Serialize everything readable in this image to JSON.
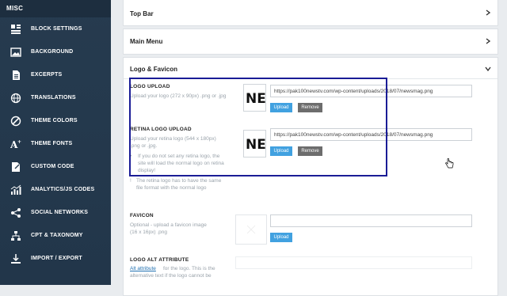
{
  "sidebar": {
    "heading": "MISC",
    "items": [
      {
        "label": "BLOCK SETTINGS",
        "icon": "layout-icon"
      },
      {
        "label": "BACKGROUND",
        "icon": "image-icon"
      },
      {
        "label": "EXCERPTS",
        "icon": "document-icon"
      },
      {
        "label": "TRANSLATIONS",
        "icon": "globe-icon"
      },
      {
        "label": "THEME COLORS",
        "icon": "palette-icon"
      },
      {
        "label": "THEME FONTS",
        "icon": "font-icon"
      },
      {
        "label": "CUSTOM CODE",
        "icon": "code-icon"
      },
      {
        "label": "ANALYTICS/JS CODES",
        "icon": "chart-icon"
      },
      {
        "label": "SOCIAL NETWORKS",
        "icon": "share-icon"
      },
      {
        "label": "CPT & TAXONOMY",
        "icon": "tree-icon"
      },
      {
        "label": "IMPORT / EXPORT",
        "icon": "import-icon"
      }
    ]
  },
  "panels": {
    "top_bar": "Top Bar",
    "main_menu": "Main Menu",
    "logo_favicon": "Logo & Favicon"
  },
  "logo_upload": {
    "label": "LOGO UPLOAD",
    "desc": "Upload your logo (272 x 90px) .png or .jpg",
    "url": "https://pak100newstv.com/wp-content/uploads/2018/07/newsmag.png",
    "preview_text": "NE",
    "upload": "Upload",
    "remove": "Remove"
  },
  "retina_logo": {
    "label": "RETINA LOGO UPLOAD",
    "desc1": "Upload your retina logo (544 x 180px)",
    "desc2": ".png or .jpg.",
    "note1": "If you do not set any retina logo, the",
    "note2": "site will load the normal logo on retina",
    "note3": "display!",
    "note4": "The retina logo has to have the same",
    "note5": "file format with the normal logo",
    "url": "https://pak100newstv.com/wp-content/uploads/2018/07/newsmag.png",
    "preview_text": "NE",
    "upload": "Upload",
    "remove": "Remove"
  },
  "favicon": {
    "label": "FAVICON",
    "desc1": "Optional - upload a favicon image",
    "desc2": "(16 x 16px) .png",
    "upload": "Upload"
  },
  "logo_alt": {
    "label": "LOGO ALT ATTRIBUTE",
    "link": "Alt attribute",
    "desc1": "for the logo. This is the",
    "desc2": "alternative text if the logo cannot be"
  },
  "colors": {
    "sidebar": "#263b4f",
    "accent": "#41a1e0",
    "highlight": "#1a1c96"
  }
}
